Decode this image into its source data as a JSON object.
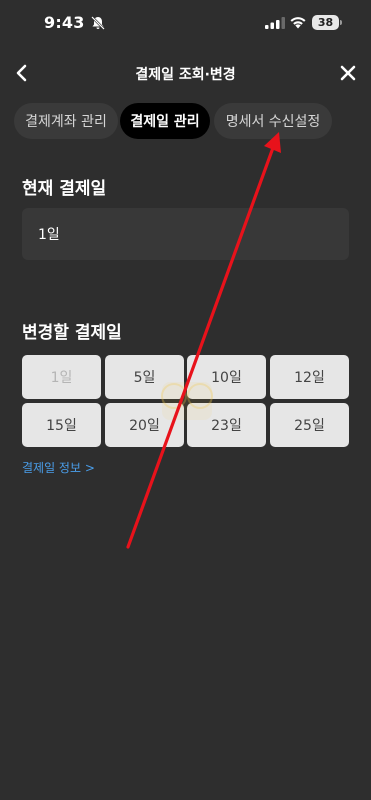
{
  "status_bar": {
    "time": "9:43",
    "battery": "38"
  },
  "header": {
    "title": "결제일 조회·변경"
  },
  "tabs": [
    {
      "label": "결제계좌 관리",
      "active": false
    },
    {
      "label": "결제일 관리",
      "active": true
    },
    {
      "label": "명세서 수신설정",
      "active": false
    }
  ],
  "current": {
    "title": "현재 결제일",
    "value": "1일"
  },
  "change": {
    "title": "변경할 결제일",
    "days": [
      "1일",
      "5일",
      "10일",
      "12일",
      "15일",
      "20일",
      "23일",
      "25일"
    ],
    "disabled_day": "1일"
  },
  "info_link": "결제일 정보 >",
  "colors": {
    "background": "#2e2e2e",
    "link": "#4a9eea",
    "annotation_arrow": "#e8121b"
  }
}
